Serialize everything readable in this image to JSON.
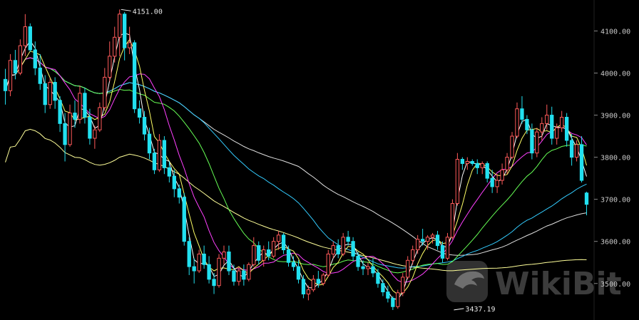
{
  "watermark": {
    "text": "WikiBit"
  },
  "chart_data": {
    "type": "candlestick",
    "title": "",
    "xlabel": "",
    "ylabel": "",
    "ylim": [
      3420,
      4160
    ],
    "y_ticks": [
      {
        "value": 4100,
        "label": "4100.00"
      },
      {
        "value": 4000,
        "label": "4000.00"
      },
      {
        "value": 3900,
        "label": "3900.00"
      },
      {
        "value": 3800,
        "label": "3800.00"
      },
      {
        "value": 3700,
        "label": "3700.00"
      },
      {
        "value": 3600,
        "label": "3600.00"
      },
      {
        "value": 3500,
        "label": "3500.00"
      }
    ],
    "annotations": [
      {
        "label": "4151.00",
        "value": 4151,
        "bar": 23
      },
      {
        "label": "3437.19",
        "value": 3437.19,
        "bar": 90
      }
    ],
    "colors": {
      "up": "#ff5a5a",
      "down": "#22e0f0",
      "ma_fast": "#ffffff",
      "ma_mid": "#ffff66",
      "ma_slow": "#ff40ff",
      "ma_green": "#66ff55",
      "ma_cyan": "#33ccff",
      "ma_white2": "#e0e0e0",
      "ma_long": "#ffff99"
    },
    "candles": [
      [
        3985,
        4010,
        3925,
        3958
      ],
      [
        3958,
        4045,
        3945,
        4030
      ],
      [
        4030,
        4055,
        3985,
        4000
      ],
      [
        4000,
        4080,
        3995,
        4065
      ],
      [
        4065,
        4140,
        4040,
        4110
      ],
      [
        4110,
        4118,
        4050,
        4055
      ],
      [
        4055,
        4075,
        3995,
        4012
      ],
      [
        4012,
        4045,
        3960,
        3975
      ],
      [
        3975,
        3995,
        3905,
        3925
      ],
      [
        3925,
        3988,
        3915,
        3978
      ],
      [
        3978,
        3990,
        3915,
        3935
      ],
      [
        3935,
        3945,
        3860,
        3880
      ],
      [
        3880,
        3905,
        3790,
        3830
      ],
      [
        3830,
        3925,
        3825,
        3905
      ],
      [
        3905,
        3935,
        3870,
        3890
      ],
      [
        3890,
        3970,
        3880,
        3952
      ],
      [
        3952,
        3965,
        3880,
        3895
      ],
      [
        3895,
        3915,
        3830,
        3845
      ],
      [
        3845,
        3875,
        3820,
        3865
      ],
      [
        3865,
        3930,
        3860,
        3918
      ],
      [
        3918,
        4012,
        3910,
        3990
      ],
      [
        3990,
        4075,
        3980,
        4040
      ],
      [
        4040,
        4110,
        4025,
        4085
      ],
      [
        4085,
        4151,
        4040,
        4140
      ],
      [
        4140,
        4145,
        4030,
        4060
      ],
      [
        4060,
        4110,
        4045,
        4072
      ],
      [
        4072,
        4078,
        3905,
        3915
      ],
      [
        3915,
        3935,
        3880,
        3895
      ],
      [
        3895,
        3910,
        3840,
        3855
      ],
      [
        3855,
        3870,
        3795,
        3810
      ],
      [
        3810,
        3820,
        3760,
        3770
      ],
      [
        3770,
        3855,
        3765,
        3840
      ],
      [
        3840,
        3850,
        3760,
        3775
      ],
      [
        3775,
        3790,
        3740,
        3755
      ],
      [
        3755,
        3770,
        3705,
        3725
      ],
      [
        3725,
        3735,
        3690,
        3705
      ],
      [
        3705,
        3715,
        3590,
        3600
      ],
      [
        3600,
        3610,
        3520,
        3540
      ],
      [
        3540,
        3560,
        3500,
        3530
      ],
      [
        3530,
        3580,
        3525,
        3570
      ],
      [
        3570,
        3590,
        3535,
        3545
      ],
      [
        3545,
        3565,
        3500,
        3510
      ],
      [
        3510,
        3525,
        3475,
        3495
      ],
      [
        3495,
        3570,
        3490,
        3560
      ],
      [
        3560,
        3590,
        3545,
        3575
      ],
      [
        3575,
        3590,
        3520,
        3530
      ],
      [
        3530,
        3545,
        3495,
        3505
      ],
      [
        3505,
        3540,
        3495,
        3530
      ],
      [
        3530,
        3545,
        3495,
        3510
      ],
      [
        3510,
        3550,
        3505,
        3545
      ],
      [
        3545,
        3610,
        3540,
        3590
      ],
      [
        3590,
        3600,
        3545,
        3555
      ],
      [
        3555,
        3590,
        3540,
        3580
      ],
      [
        3580,
        3600,
        3555,
        3565
      ],
      [
        3565,
        3610,
        3560,
        3600
      ],
      [
        3600,
        3625,
        3580,
        3615
      ],
      [
        3615,
        3620,
        3570,
        3580
      ],
      [
        3580,
        3590,
        3540,
        3550
      ],
      [
        3550,
        3565,
        3530,
        3540
      ],
      [
        3540,
        3555,
        3500,
        3510
      ],
      [
        3510,
        3520,
        3465,
        3475
      ],
      [
        3475,
        3495,
        3460,
        3485
      ],
      [
        3485,
        3520,
        3480,
        3510
      ],
      [
        3510,
        3530,
        3490,
        3500
      ],
      [
        3500,
        3525,
        3495,
        3520
      ],
      [
        3520,
        3580,
        3515,
        3570
      ],
      [
        3570,
        3600,
        3560,
        3590
      ],
      [
        3590,
        3605,
        3560,
        3570
      ],
      [
        3570,
        3620,
        3565,
        3610
      ],
      [
        3610,
        3625,
        3590,
        3600
      ],
      [
        3600,
        3610,
        3555,
        3565
      ],
      [
        3565,
        3575,
        3530,
        3540
      ],
      [
        3540,
        3555,
        3520,
        3535
      ],
      [
        3535,
        3550,
        3520,
        3540
      ],
      [
        3540,
        3560,
        3515,
        3525
      ],
      [
        3525,
        3535,
        3490,
        3500
      ],
      [
        3500,
        3510,
        3470,
        3480
      ],
      [
        3480,
        3495,
        3455,
        3465
      ],
      [
        3465,
        3470,
        3437,
        3445
      ],
      [
        3445,
        3485,
        3440,
        3478
      ],
      [
        3478,
        3525,
        3470,
        3515
      ],
      [
        3515,
        3565,
        3510,
        3555
      ],
      [
        3555,
        3590,
        3545,
        3580
      ],
      [
        3580,
        3615,
        3570,
        3605
      ],
      [
        3605,
        3630,
        3590,
        3600
      ],
      [
        3600,
        3615,
        3580,
        3610
      ],
      [
        3610,
        3620,
        3595,
        3615
      ],
      [
        3615,
        3625,
        3580,
        3590
      ],
      [
        3590,
        3600,
        3550,
        3560
      ],
      [
        3560,
        3620,
        3555,
        3610
      ],
      [
        3610,
        3700,
        3605,
        3690
      ],
      [
        3690,
        3810,
        3685,
        3795
      ],
      [
        3795,
        3800,
        3770,
        3785
      ],
      [
        3785,
        3800,
        3770,
        3790
      ],
      [
        3790,
        3795,
        3780,
        3785
      ],
      [
        3785,
        3795,
        3760,
        3775
      ],
      [
        3775,
        3790,
        3760,
        3785
      ],
      [
        3785,
        3790,
        3740,
        3750
      ],
      [
        3750,
        3770,
        3715,
        3730
      ],
      [
        3730,
        3760,
        3715,
        3745
      ],
      [
        3745,
        3785,
        3735,
        3770
      ],
      [
        3770,
        3810,
        3760,
        3800
      ],
      [
        3800,
        3860,
        3795,
        3850
      ],
      [
        3850,
        3930,
        3845,
        3915
      ],
      [
        3915,
        3945,
        3880,
        3890
      ],
      [
        3890,
        3900,
        3855,
        3865
      ],
      [
        3865,
        3880,
        3795,
        3810
      ],
      [
        3810,
        3870,
        3800,
        3860
      ],
      [
        3860,
        3895,
        3840,
        3880
      ],
      [
        3880,
        3925,
        3865,
        3900
      ],
      [
        3900,
        3920,
        3830,
        3845
      ],
      [
        3845,
        3880,
        3830,
        3870
      ],
      [
        3870,
        3910,
        3860,
        3895
      ],
      [
        3895,
        3905,
        3825,
        3840
      ],
      [
        3840,
        3855,
        3780,
        3800
      ],
      [
        3800,
        3840,
        3790,
        3830
      ],
      [
        3830,
        3850,
        3740,
        3745
      ],
      [
        3715,
        3718,
        3662,
        3688
      ]
    ]
  }
}
